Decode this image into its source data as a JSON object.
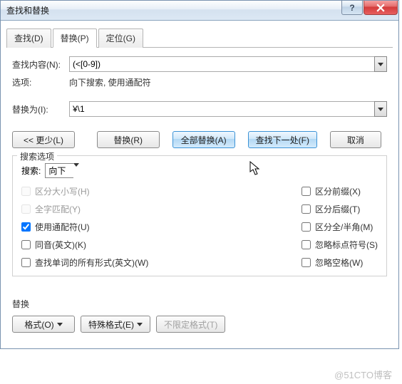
{
  "title": "查找和替换",
  "tabs": {
    "find": "查找(D)",
    "replace": "替换(P)",
    "goto": "定位(G)"
  },
  "labels": {
    "findWhat": "查找内容(N):",
    "options": "选项:",
    "optionsValue": "向下搜索, 使用通配符",
    "replaceWith": "替换为(I):"
  },
  "values": {
    "findWhat": "(<[0-9])",
    "replaceWith": "¥\\1"
  },
  "buttons": {
    "less": "<< 更少(L)",
    "replace": "替换(R)",
    "replaceAll": "全部替换(A)",
    "findNext": "查找下一处(F)",
    "cancel": "取消"
  },
  "searchOptions": {
    "legend": "搜索选项",
    "searchLabel": "搜索:",
    "direction": "向下",
    "left": {
      "matchCase": "区分大小写(H)",
      "wholeWord": "全字匹配(Y)",
      "wildcards": "使用通配符(U)",
      "soundsLike": "同音(英文)(K)",
      "wordForms": "查找单词的所有形式(英文)(W)"
    },
    "right": {
      "prefix": "区分前缀(X)",
      "suffix": "区分后缀(T)",
      "fullHalf": "区分全/半角(M)",
      "ignorePunct": "忽略标点符号(S)",
      "ignoreSpace": "忽略空格(W)"
    }
  },
  "format": {
    "label": "替换",
    "formatBtn": "格式(O)",
    "specialBtn": "特殊格式(E)",
    "noFormatBtn": "不限定格式(T)"
  },
  "watermark": "@51CTO博客"
}
